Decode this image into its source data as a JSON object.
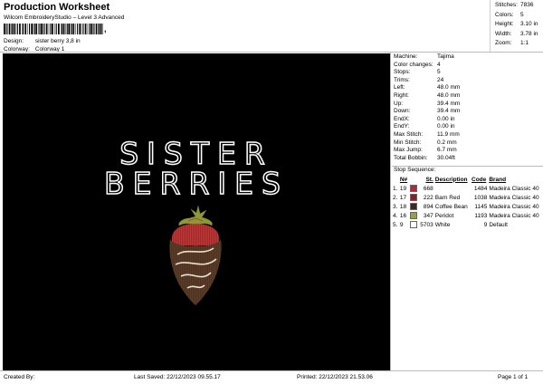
{
  "header": {
    "title": "Production Worksheet",
    "subtitle": "Wilcom EmbroideryStudio – Level 3 Advanced",
    "barcode_suffix": ","
  },
  "design_info": [
    {
      "label": "Design:",
      "value": "sister berry 3,8 in"
    },
    {
      "label": "Colorway:",
      "value": "Colorway 1"
    }
  ],
  "stats": [
    {
      "label": "Stitches:",
      "value": "7836"
    },
    {
      "label": "Colors:",
      "value": "5"
    },
    {
      "label": "Height:",
      "value": "3.10 in"
    },
    {
      "label": "Width:",
      "value": "3.78 in"
    },
    {
      "label": "Zoom:",
      "value": "1:1"
    }
  ],
  "design_text": {
    "line1": "SISTER",
    "line2": "BERRIES"
  },
  "machine_info": [
    {
      "label": "Machine:",
      "value": "Tajima"
    },
    {
      "label": "Color changes:",
      "value": "4"
    },
    {
      "label": "Stops:",
      "value": "5"
    },
    {
      "label": "Trims:",
      "value": "24"
    },
    {
      "label": "Left:",
      "value": "48.0 mm"
    },
    {
      "label": "Right:",
      "value": "48.0 mm"
    },
    {
      "label": "Up:",
      "value": "39.4 mm"
    },
    {
      "label": "Down:",
      "value": "39.4 mm"
    },
    {
      "label": "EndX:",
      "value": "0.00 in"
    },
    {
      "label": "EndY:",
      "value": "0.00 in"
    },
    {
      "label": "Max Stitch:",
      "value": "11.9 mm"
    },
    {
      "label": "Min Stitch:",
      "value": "0.2 mm"
    },
    {
      "label": "Max Jump:",
      "value": "6.7 mm"
    },
    {
      "label": "Total Bobbin:",
      "value": "30.04ft"
    }
  ],
  "stop_sequence": {
    "title": "Stop Sequence:",
    "headers": [
      "",
      "N#",
      "",
      "St.",
      "Description",
      "Code",
      "Brand"
    ],
    "rows": [
      {
        "idx": "1.",
        "n": "19",
        "color": "#b02a3a",
        "st": "668",
        "desc": "",
        "code": "1484",
        "brand": "Madeira Classic 40"
      },
      {
        "idx": "2.",
        "n": "17",
        "color": "#8a1f2a",
        "st": "222",
        "desc": "Barn Red",
        "code": "1038",
        "brand": "Madeira Classic 40"
      },
      {
        "idx": "3.",
        "n": "18",
        "color": "#3b2a1e",
        "st": "894",
        "desc": "Coffee Bean",
        "code": "1145",
        "brand": "Madeira Classic 40"
      },
      {
        "idx": "4.",
        "n": "16",
        "color": "#9aa04a",
        "st": "347",
        "desc": "Peridot",
        "code": "1193",
        "brand": "Madeira Classic 40"
      },
      {
        "idx": "5.",
        "n": "9",
        "color": "#ffffff",
        "st": "5703",
        "desc": "White",
        "code": "9",
        "brand": "Default"
      }
    ]
  },
  "footer": {
    "created_by": "Created By:",
    "last_saved": "Last Saved: 22/12/2023 09.55.17",
    "printed": "Printed: 22/12/2023 21.53.06",
    "page": "Page 1 of 1"
  }
}
